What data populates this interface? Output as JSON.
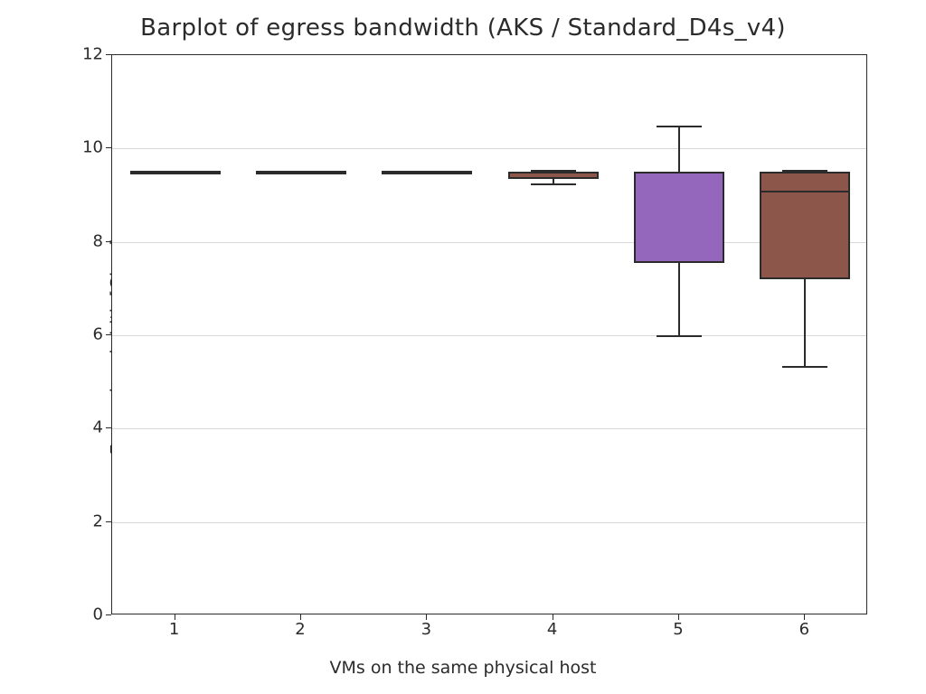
{
  "chart_data": {
    "type": "box",
    "title": "Barplot of egress bandwidth (AKS / Standard_D4s_v4)",
    "xlabel": "VMs on the same physical host",
    "ylabel": "Egress bandwidth [Gbps]",
    "ylim": [
      0,
      12
    ],
    "yticks": [
      0,
      2,
      4,
      6,
      8,
      10,
      12
    ],
    "categories": [
      "1",
      "2",
      "3",
      "4",
      "5",
      "6"
    ],
    "series": [
      {
        "name": "1",
        "min": 9.5,
        "q1": 9.5,
        "median": 9.5,
        "q3": 9.5,
        "max": 9.5,
        "color": "#9467bd"
      },
      {
        "name": "2",
        "min": 9.5,
        "q1": 9.5,
        "median": 9.5,
        "q3": 9.5,
        "max": 9.5,
        "color": "#8c564b"
      },
      {
        "name": "3",
        "min": 9.5,
        "q1": 9.5,
        "median": 9.5,
        "q3": 9.5,
        "max": 9.5,
        "color": "#9467bd"
      },
      {
        "name": "4",
        "min": 9.25,
        "q1": 9.35,
        "median": 9.5,
        "q3": 9.5,
        "max": 9.55,
        "color": "#8c564b"
      },
      {
        "name": "5",
        "min": 6.0,
        "q1": 7.55,
        "median": 9.5,
        "q3": 9.5,
        "max": 10.5,
        "color": "#9467bd"
      },
      {
        "name": "6",
        "min": 5.35,
        "q1": 7.2,
        "median": 9.1,
        "q3": 9.5,
        "max": 9.55,
        "color": "#8c564b"
      }
    ]
  }
}
